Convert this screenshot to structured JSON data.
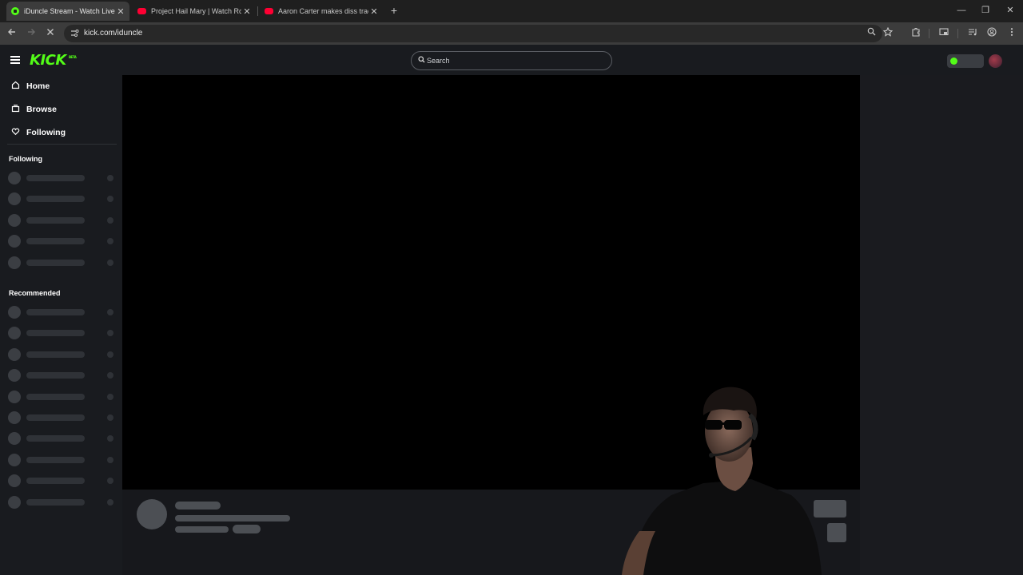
{
  "browser": {
    "tabs": [
      {
        "title": "iDuncle Stream - Watch Live on Kick",
        "icon": "kick-favicon",
        "active": true
      },
      {
        "title": "Project Hail Mary | Watch Rocky",
        "icon": "youtube-favicon",
        "active": false
      },
      {
        "title": "Aaron Carter makes diss track on",
        "icon": "youtube-favicon",
        "active": false
      }
    ],
    "close_glyph": "✕",
    "new_tab_glyph": "+",
    "window_controls": {
      "minimize": "—",
      "restore": "❐",
      "close": "✕"
    },
    "url": "kick.com/iduncle"
  },
  "header": {
    "logo": "KICK",
    "logo_badge": "BETA",
    "search_placeholder": "Search"
  },
  "sidebar": {
    "nav": [
      {
        "label": "Home",
        "icon": "home-icon"
      },
      {
        "label": "Browse",
        "icon": "browse-icon"
      },
      {
        "label": "Following",
        "icon": "heart-icon"
      }
    ],
    "following_title": "Following",
    "recommended_title": "Recommended"
  },
  "colors": {
    "accent": "#53fc18",
    "background": "#191b1f",
    "player": "#000000",
    "skeleton": "#2f3237"
  }
}
